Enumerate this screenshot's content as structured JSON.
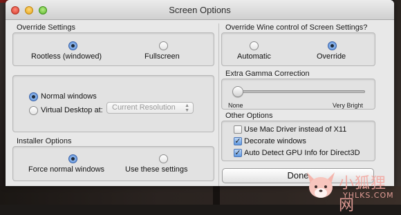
{
  "window": {
    "title": "Screen Options"
  },
  "override_settings": {
    "label": "Override Settings",
    "options": [
      {
        "label": "Rootless (windowed)",
        "selected": true
      },
      {
        "label": "Fullscreen",
        "selected": false
      }
    ]
  },
  "windows_mode": {
    "options": [
      {
        "label": "Normal windows",
        "selected": true
      },
      {
        "label": "Virtual Desktop at:",
        "selected": false
      }
    ],
    "resolution_select": {
      "value": "Current Resolution",
      "enabled": false
    }
  },
  "installer_options": {
    "label": "Installer Options",
    "options": [
      {
        "label": "Force normal windows",
        "selected": true
      },
      {
        "label": "Use these settings",
        "selected": false
      }
    ]
  },
  "override_wine": {
    "label": "Override Wine control of Screen Settings?",
    "options": [
      {
        "label": "Automatic",
        "selected": false
      },
      {
        "label": "Override",
        "selected": true
      }
    ]
  },
  "gamma": {
    "label": "Extra Gamma Correction",
    "min_label": "None",
    "max_label": "Very Bright",
    "value": 0
  },
  "other_options": {
    "label": "Other Options",
    "checkboxes": [
      {
        "label": "Use Mac Driver instead of X11",
        "checked": false
      },
      {
        "label": "Decorate windows",
        "checked": true
      },
      {
        "label": "Auto Detect GPU Info for Direct3D",
        "checked": true
      }
    ]
  },
  "done_button": {
    "label": "Done"
  },
  "watermark": {
    "text": "小狐狸网",
    "subtext": "YHLKS.COM"
  },
  "colors": {
    "window_bg": "#e8e8e8",
    "radio_selected": "#4e86d6",
    "checkbox_checked": "#5f98e0"
  }
}
